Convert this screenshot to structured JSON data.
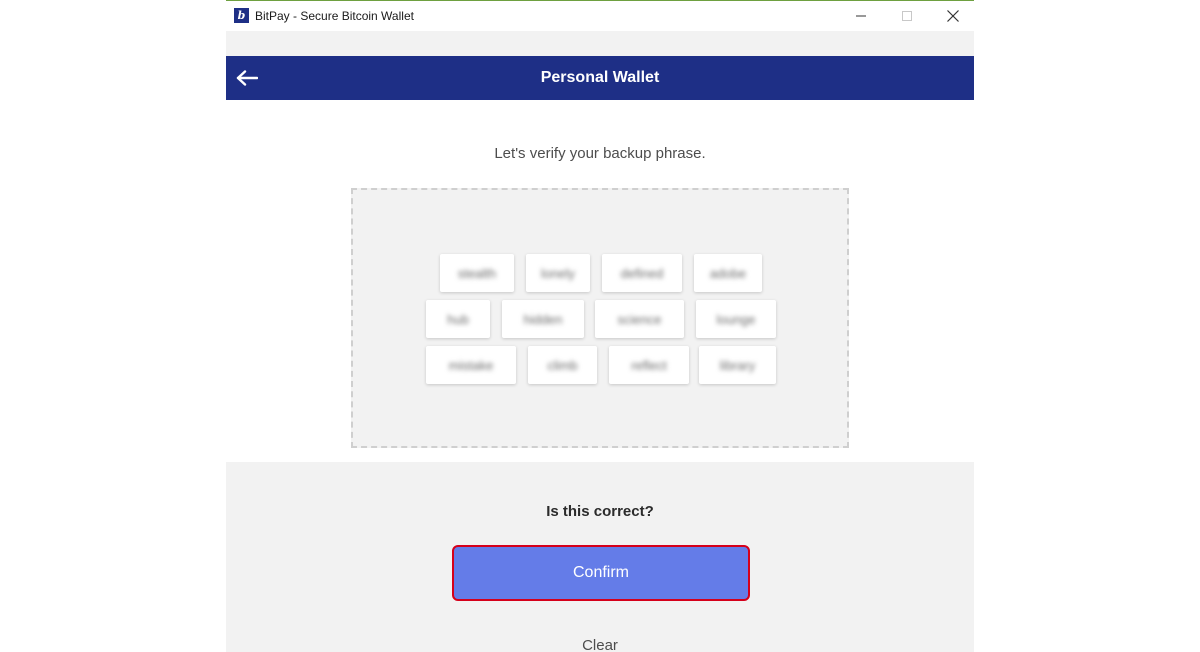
{
  "window": {
    "title": "BitPay - Secure Bitcoin Wallet",
    "app_icon_letter": "b"
  },
  "header": {
    "title": "Personal Wallet",
    "back_icon": "arrow-left-icon"
  },
  "instruction": "Let's verify your backup phrase.",
  "words": [
    "stealth",
    "lonely",
    "defined",
    "adobe",
    "hub",
    "hidden",
    "science",
    "lounge",
    "mistake",
    "climb",
    "reflect",
    "library"
  ],
  "words_note_blurred": true,
  "confirm_section": {
    "question": "Is this correct?",
    "confirm_label": "Confirm",
    "clear_label": "Clear"
  },
  "colors": {
    "header": "#1e2f86",
    "confirm_button": "#647ce8",
    "confirm_border": "#d5001b",
    "panel": "#f2f2f2"
  }
}
